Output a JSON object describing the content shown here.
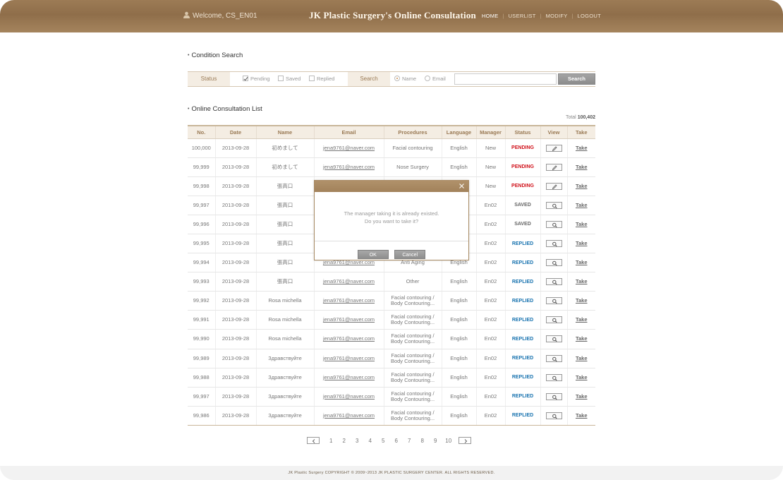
{
  "header": {
    "welcome": "Welcome, CS_EN01",
    "title": "JK Plastic Surgery's Online Consultation",
    "nav": [
      {
        "label": "HOME",
        "active": true
      },
      {
        "label": "USERLIST",
        "active": false
      },
      {
        "label": "MODIFY",
        "active": false
      },
      {
        "label": "LOGOUT",
        "active": false
      }
    ]
  },
  "search": {
    "section_title": "Condition Search",
    "status_label": "Status",
    "status_options": [
      {
        "label": "Pending",
        "checked": true
      },
      {
        "label": "Saved",
        "checked": false
      },
      {
        "label": "Replied",
        "checked": false
      }
    ],
    "search_label": "Search",
    "search_by": [
      {
        "label": "Name",
        "checked": true
      },
      {
        "label": "Email",
        "checked": false
      }
    ],
    "input_value": "",
    "button_label": "Search"
  },
  "list": {
    "section_title": "Online Consultation List",
    "total_label": "Total",
    "total_value": "100,402",
    "columns": [
      "No.",
      "Date",
      "Name",
      "Email",
      "Procedures",
      "Language",
      "Manager",
      "Status",
      "View",
      "Take"
    ],
    "rows": [
      {
        "no": "100,000",
        "date": "2013-09-28",
        "name": "初めまして",
        "email": "jena9761@naver.com",
        "procedure": "Facial contouring",
        "procedure2": "",
        "language": "English",
        "manager": "New",
        "status": "PENDING",
        "view": "edit",
        "take": "Take"
      },
      {
        "no": "99,999",
        "date": "2013-09-28",
        "name": "初めまして",
        "email": "jena9761@naver.com",
        "procedure": "Nose Surgery",
        "procedure2": "",
        "language": "English",
        "manager": "New",
        "status": "PENDING",
        "view": "edit",
        "take": "Take"
      },
      {
        "no": "99,998",
        "date": "2013-09-28",
        "name": "張高口",
        "email": "",
        "procedure": "",
        "procedure2": "",
        "language": "",
        "manager": "New",
        "status": "PENDING",
        "view": "edit",
        "take": "Take"
      },
      {
        "no": "99,997",
        "date": "2013-09-28",
        "name": "張高口",
        "email": "",
        "procedure": "",
        "procedure2": "",
        "language": "",
        "manager": "En02",
        "status": "SAVED",
        "view": "search",
        "take": "Take"
      },
      {
        "no": "99,996",
        "date": "2013-09-28",
        "name": "張高口",
        "email": "",
        "procedure": "",
        "procedure2": "",
        "language": "",
        "manager": "En02",
        "status": "SAVED",
        "view": "search",
        "take": "Take"
      },
      {
        "no": "99,995",
        "date": "2013-09-28",
        "name": "張高口",
        "email": "",
        "procedure": "",
        "procedure2": "",
        "language": "",
        "manager": "En02",
        "status": "REPLIED",
        "view": "search",
        "take": "Take"
      },
      {
        "no": "99,994",
        "date": "2013-09-28",
        "name": "張高口",
        "email": "jena9761@naver.com",
        "procedure": "Anti Aging",
        "procedure2": "",
        "language": "English",
        "manager": "En02",
        "status": "REPLIED",
        "view": "search",
        "take": "Take"
      },
      {
        "no": "99,993",
        "date": "2013-09-28",
        "name": "張高口",
        "email": "jena9761@naver.com",
        "procedure": "Other",
        "procedure2": "",
        "language": "English",
        "manager": "En02",
        "status": "REPLIED",
        "view": "search",
        "take": "Take"
      },
      {
        "no": "99,992",
        "date": "2013-09-28",
        "name": "Rosa michella",
        "email": "jena9761@naver.com",
        "procedure": "Facial contouring /",
        "procedure2": "Body Contouring...",
        "language": "English",
        "manager": "En02",
        "status": "REPLIED",
        "view": "search",
        "take": "Take"
      },
      {
        "no": "99,991",
        "date": "2013-09-28",
        "name": "Rosa michella",
        "email": "jena9761@naver.com",
        "procedure": "Facial contouring /",
        "procedure2": "Body Contouring...",
        "language": "English",
        "manager": "En02",
        "status": "REPLIED",
        "view": "search",
        "take": "Take"
      },
      {
        "no": "99,990",
        "date": "2013-09-28",
        "name": "Rosa michella",
        "email": "jena9761@naver.com",
        "procedure": "Facial contouring /",
        "procedure2": "Body Contouring...",
        "language": "English",
        "manager": "En02",
        "status": "REPLIED",
        "view": "search",
        "take": "Take"
      },
      {
        "no": "99,989",
        "date": "2013-09-28",
        "name": "Здравствуйте",
        "email": "jena9761@naver.com",
        "procedure": "Facial contouring /",
        "procedure2": "Body Contouring...",
        "language": "English",
        "manager": "En02",
        "status": "REPLIED",
        "view": "search",
        "take": "Take"
      },
      {
        "no": "99,988",
        "date": "2013-09-28",
        "name": "Здравствуйте",
        "email": "jena9761@naver.com",
        "procedure": "Facial contouring /",
        "procedure2": "Body Contouring...",
        "language": "English",
        "manager": "En02",
        "status": "REPLIED",
        "view": "search",
        "take": "Take"
      },
      {
        "no": "99,997",
        "date": "2013-09-28",
        "name": "Здравствуйте",
        "email": "jena9761@naver.com",
        "procedure": "Facial contouring /",
        "procedure2": "Body Contouring...",
        "language": "English",
        "manager": "En02",
        "status": "REPLIED",
        "view": "search",
        "take": "Take"
      },
      {
        "no": "99,986",
        "date": "2013-09-28",
        "name": "Здравствуйте",
        "email": "jena9761@naver.com",
        "procedure": "Facial contouring /",
        "procedure2": "Body Contouring...",
        "language": "English",
        "manager": "En02",
        "status": "REPLIED",
        "view": "search",
        "take": "Take"
      }
    ]
  },
  "pager": {
    "pages": [
      "1",
      "2",
      "3",
      "4",
      "5",
      "6",
      "7",
      "8",
      "9",
      "10"
    ]
  },
  "modal": {
    "line1": "The manager taking it is already existed.",
    "line2": "Do you want to take it?",
    "ok_label": "OK",
    "cancel_label": "Cancel"
  },
  "footer": {
    "text": "JK Plastic Surgery   COPYRIGHT © 2009~2013 JK PLASTIC SURGERY CENTER. ALL RIGHTS RESERVED."
  },
  "colors": {
    "header_brown": "#9c7b55",
    "pending": "#d0121b",
    "replied": "#1a74b0",
    "label_bg": "#f4ede3"
  }
}
